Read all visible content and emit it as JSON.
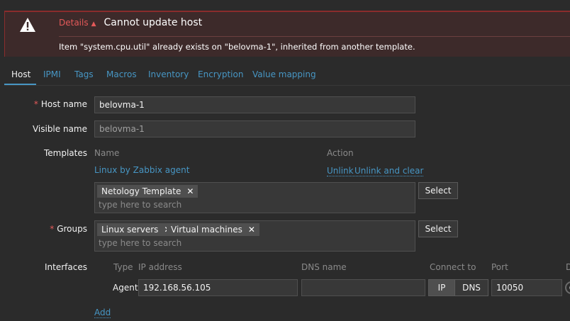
{
  "error": {
    "details_label": "Details",
    "details_arrow": "▲",
    "title": "Cannot update host",
    "message": "Item \"system.cpu.util\" already exists on \"belovma-1\", inherited from another template."
  },
  "tabs": [
    {
      "label": "Host",
      "active": true
    },
    {
      "label": "IPMI"
    },
    {
      "label": "Tags"
    },
    {
      "label": "Macros"
    },
    {
      "label": "Inventory"
    },
    {
      "label": "Encryption"
    },
    {
      "label": "Value mapping"
    }
  ],
  "form": {
    "host_name": {
      "required_mark": "*",
      "label": "Host name",
      "value": "belovma-1"
    },
    "visible_name": {
      "label": "Visible name",
      "value": "belovma-1"
    },
    "templates": {
      "label": "Templates",
      "col_name": "Name",
      "col_action": "Action",
      "linked": [
        {
          "name": "Linux by Zabbix agent",
          "unlink": "Unlink",
          "unlink_clear": "Unlink and clear"
        }
      ],
      "chips": [
        "Netology Template"
      ],
      "placeholder": "type here to search",
      "select_label": "Select"
    },
    "groups": {
      "required_mark": "*",
      "label": "Groups",
      "chips": [
        "Linux servers",
        "Virtual machines"
      ],
      "placeholder": "type here to search",
      "select_label": "Select"
    },
    "interfaces": {
      "label": "Interfaces",
      "headers": {
        "type": "Type",
        "ip": "IP address",
        "dns": "DNS name",
        "connect": "Connect to",
        "port": "Port",
        "default": "D"
      },
      "rows": [
        {
          "type": "Agent",
          "ip": "192.168.56.105",
          "dns": "",
          "connect_ip": "IP",
          "connect_dns": "DNS",
          "port": "10050"
        }
      ],
      "add_label": "Add"
    }
  },
  "icons": {
    "error": "warning-triangle-icon",
    "chip_remove": "close-icon"
  },
  "colors": {
    "accent": "#4796c4",
    "error": "#e45959",
    "background": "#2b2b2b"
  }
}
